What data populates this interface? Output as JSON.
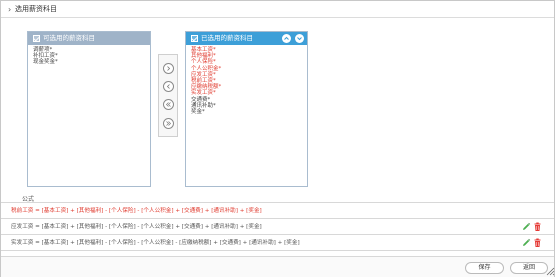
{
  "header": {
    "title": "选用薪资科目"
  },
  "left_panel": {
    "title": "可选用的薪资科目",
    "items": [
      "调薪项*",
      "补扣工资*",
      "现金奖金*"
    ]
  },
  "right_panel": {
    "title": "已选用的薪资科目",
    "items": [
      {
        "label": "基本工资*",
        "color": "#e03b2f"
      },
      {
        "label": "其他福利*",
        "color": "#e03b2f"
      },
      {
        "label": "个人保险*",
        "color": "#e03b2f"
      },
      {
        "label": "个人公积金*",
        "color": "#e03b2f"
      },
      {
        "label": "应发工资*",
        "color": "#e03b2f"
      },
      {
        "label": "税前工资*",
        "color": "#e03b2f"
      },
      {
        "label": "应缴纳税额*",
        "color": "#e03b2f"
      },
      {
        "label": "实发工资*",
        "color": "#e03b2f"
      },
      {
        "label": "交通费*",
        "color": "#444444"
      },
      {
        "label": "通讯补助*",
        "color": "#444444"
      },
      {
        "label": "奖金*",
        "color": "#444444"
      }
    ]
  },
  "formula": {
    "label": "公式",
    "rows": [
      {
        "text": "税前工资 = [基本工资] + [其他福利] - [个人保险] - [个人公积金] + [交通费] + [通讯补助] + [奖金]",
        "color": "red",
        "editable": false
      },
      {
        "text": "应发工资 = [基本工资] + [其他福利] - [个人保险] - [个人公积金] + [交通费] + [通讯补助] + [奖金]",
        "color": "dark",
        "editable": true
      },
      {
        "text": "实发工资 = [基本工资] + [其他福利] - [个人保险] - [个人公积金] - [应缴纳税额] + [交通费] + [通讯补助] + [奖金]",
        "color": "dark",
        "editable": true
      }
    ]
  },
  "buttons": {
    "save": "保存",
    "back": "返回"
  },
  "icons": [
    "chevron-right-icon",
    "checkbox-checked-icon",
    "move-up-icon",
    "move-down-icon",
    "add-one-icon",
    "remove-one-icon",
    "remove-all-icon",
    "add-all-icon",
    "edit-icon",
    "delete-icon",
    "resize-corner-icon"
  ],
  "colors": {
    "accent": "#3d9fd8",
    "inactive_header": "#9fb3c8",
    "required_red": "#e03b2f",
    "edit_green": "#4caf50",
    "delete_red": "#e53935"
  }
}
